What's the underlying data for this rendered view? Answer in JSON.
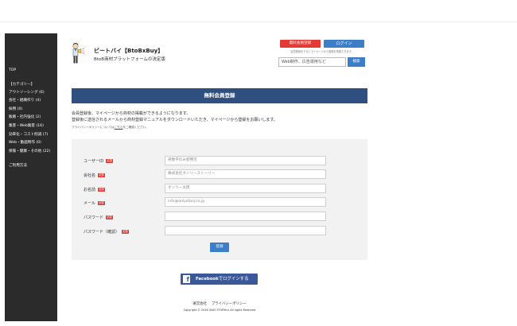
{
  "sidebar": {
    "top": "TOP",
    "category_heading": "【カテゴリー】",
    "categories": [
      "アウトソーシング (6)",
      "会社・組織作り (4)",
      "採用 (0)",
      "販路・社内強化 (2)",
      "集客・Web集客 (16)",
      "効率化・コスト削減 (7)",
      "Web・動画制作 (0)",
      "保険・健康・その他 (22)"
    ],
    "guide": "ご利用方法"
  },
  "header": {
    "site_title": "ビートバイ【BtoBxBuy】",
    "site_subtitle": "BtoB商材プラットフォームの決定版",
    "register_button": "無料会員登録",
    "login_button": "ログイン",
    "note": "会員登録をするとマイページから登録を掲載できます。",
    "search_value": "Web制作、広告運用など",
    "search_button": "検索"
  },
  "page": {
    "banner": "無料会員登録",
    "intro_line1": "会員登録後、マイページから商材の掲載ができるようになります。",
    "intro_line2": "登録後に送信されるメールから商材登録マニュアルをダウンロードいただき、マイページから登録をお願いします。",
    "policy_before": "プライバシーポリシーについては",
    "policy_link": "こちら",
    "policy_after": "をご確認ください。"
  },
  "form": {
    "required_badge": "必須",
    "fields": [
      {
        "label": "ユーザーID",
        "placeholder": "英数字のみ使用可"
      },
      {
        "label": "会社名",
        "placeholder": "株式会社オンリーストーリー"
      },
      {
        "label": "お名前",
        "placeholder": "オンリー太郎"
      },
      {
        "label": "メール",
        "placeholder": "info@onlystory.co.jp"
      },
      {
        "label": "パスワード",
        "placeholder": ""
      },
      {
        "label": "パスワード（確認）",
        "placeholder": ""
      }
    ],
    "submit_label": "登録"
  },
  "facebook": {
    "icon_glyph": "f",
    "brand": "Facebook",
    "action": "でログインする"
  },
  "footer": {
    "links": [
      "運営会社",
      "プライバシーポリシー"
    ],
    "copyright": "Copyright © 2016 ONLY STORYinc All rights Reserved"
  },
  "colors": {
    "sidebar_bg": "#2b2b2b",
    "banner_bg": "#2e4f7f",
    "accent_red": "#e53935",
    "accent_blue": "#3d7ec9",
    "facebook_blue": "#3b5998"
  }
}
